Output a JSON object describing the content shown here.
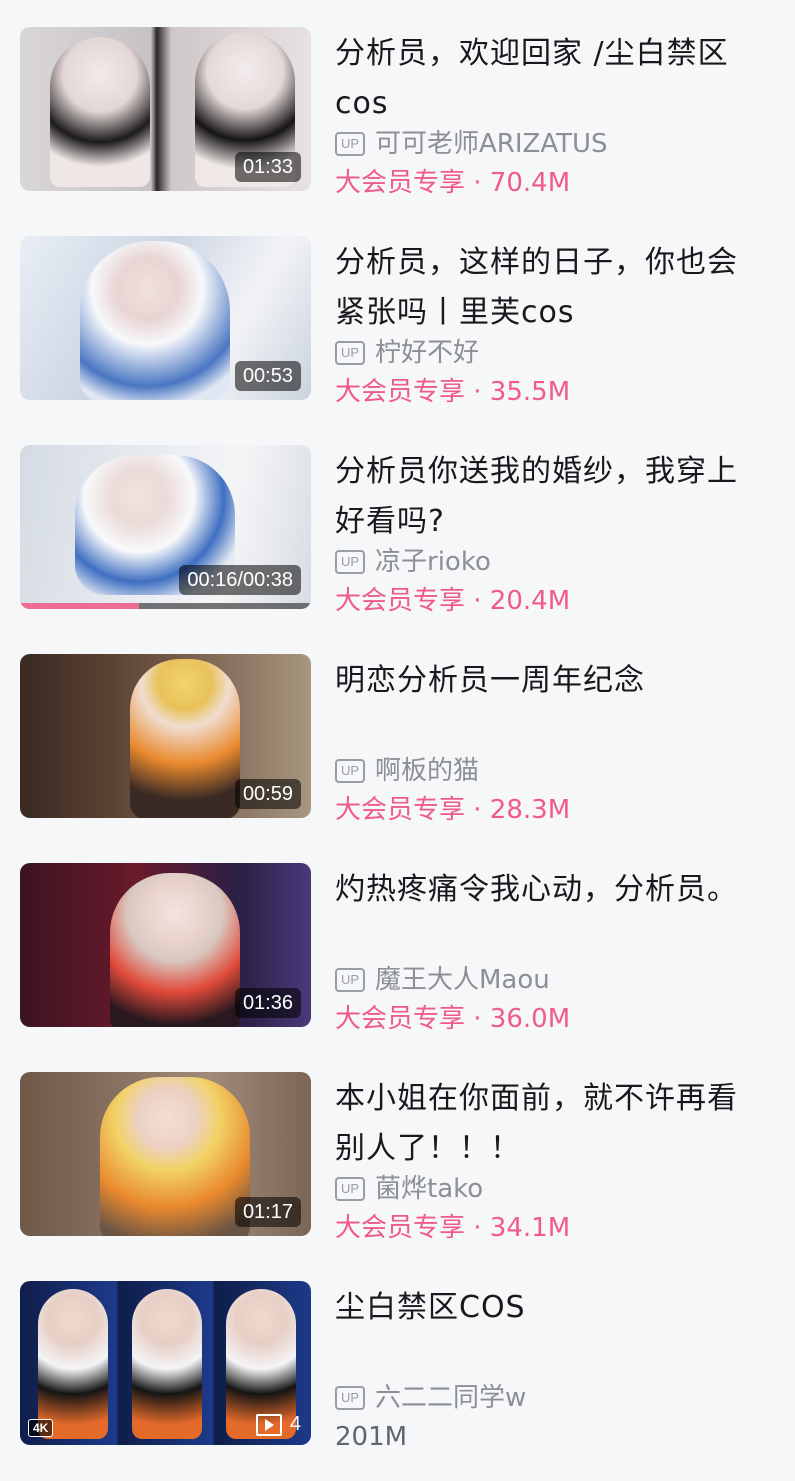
{
  "videos": [
    {
      "title": "分析员，欢迎回家 /尘白禁区cos",
      "up_icon": "UP",
      "uploader": "可可老师ARIZATUS",
      "vip": "大会员专享",
      "views": "· 70.4M",
      "duration": "01:33"
    },
    {
      "title": "分析员，这样的日子，你也会紧张吗丨里芙cos",
      "up_icon": "UP",
      "uploader": "柠好不好",
      "vip": "大会员专享",
      "views": "· 35.5M",
      "duration": "00:53"
    },
    {
      "title": "分析员你送我的婚纱，我穿上好看吗?",
      "up_icon": "UP",
      "uploader": "凉子rioko",
      "vip": "大会员专享",
      "views": "· 20.4M",
      "duration": "00:16/00:38",
      "progress": 0.41
    },
    {
      "title": "明恋分析员一周年纪念",
      "up_icon": "UP",
      "uploader": "啊板的猫",
      "vip": "大会员专享",
      "views": "· 28.3M",
      "duration": "00:59"
    },
    {
      "title": "灼热疼痛令我心动，分析员。",
      "up_icon": "UP",
      "uploader": "魔王大人Maou",
      "vip": "大会员专享",
      "views": "· 36.0M",
      "duration": "01:36"
    },
    {
      "title": "本小姐在你面前，就不许再看别人了！！！",
      "up_icon": "UP",
      "uploader": "菌烨tako",
      "vip": "大会员专享",
      "views": "· 34.1M",
      "duration": "01:17"
    },
    {
      "title": "尘白禁区COS",
      "up_icon": "UP",
      "uploader": "六二二同学w",
      "views_plain": "201M",
      "badge": "4K",
      "page_count": "4"
    }
  ],
  "icons": {
    "up": "up-badge-icon",
    "pages": "multi-page-play-icon"
  },
  "colors": {
    "vip": "#f05a8c",
    "progress": "#f06c96",
    "text": "#18191c",
    "muted": "#8c8f94"
  }
}
